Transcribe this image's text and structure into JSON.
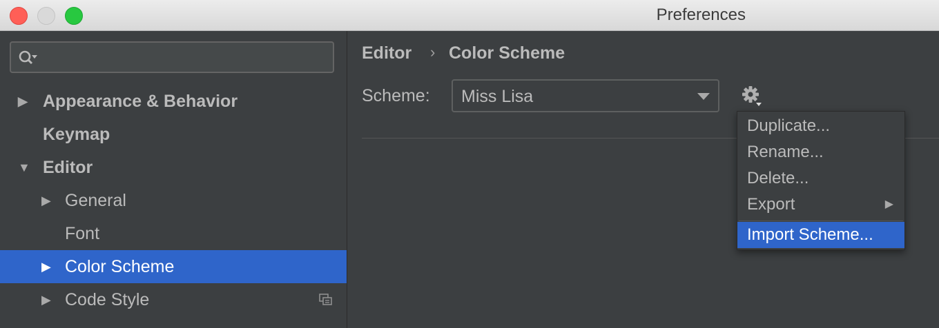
{
  "window": {
    "title": "Preferences"
  },
  "search": {
    "placeholder": ""
  },
  "sidebar": {
    "items": [
      {
        "label": "Appearance & Behavior",
        "expander": "▶"
      },
      {
        "label": "Keymap",
        "expander": ""
      },
      {
        "label": "Editor",
        "expander": "▼"
      },
      {
        "label": "General",
        "expander": "▶"
      },
      {
        "label": "Font",
        "expander": ""
      },
      {
        "label": "Color Scheme",
        "expander": "▶",
        "selected": true
      },
      {
        "label": "Code Style",
        "expander": "▶"
      }
    ]
  },
  "breadcrumb": {
    "parent": "Editor",
    "separator": "›",
    "current": "Color Scheme"
  },
  "scheme": {
    "label": "Scheme:",
    "value": "Miss Lisa"
  },
  "menu": {
    "items": [
      {
        "label": "Duplicate..."
      },
      {
        "label": "Rename..."
      },
      {
        "label": "Delete..."
      },
      {
        "label": "Export",
        "submenu_arrow": "▶"
      },
      {
        "label": "Import Scheme...",
        "highlighted": true
      }
    ]
  },
  "colors": {
    "selection": "#2f65ca",
    "background": "#3c3f41",
    "text": "#bbbbbb"
  }
}
